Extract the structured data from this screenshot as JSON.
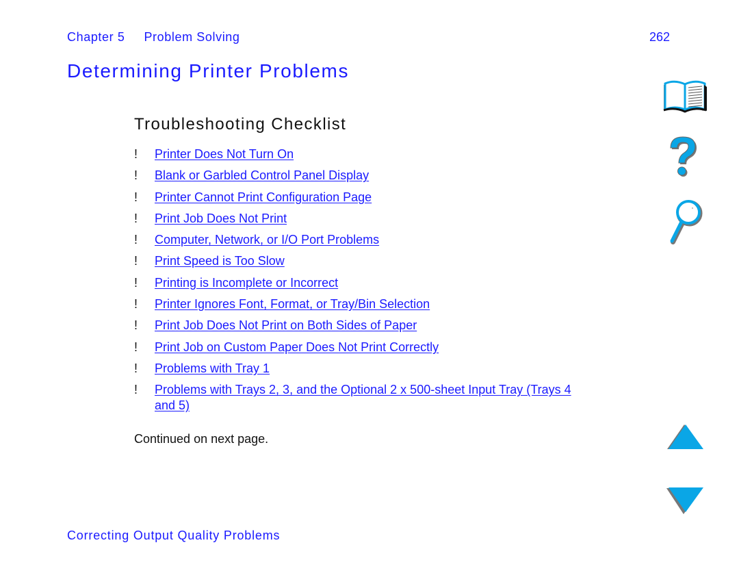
{
  "header": {
    "chapter_label": "Chapter 5",
    "chapter_title": "Problem Solving",
    "page_number": "262"
  },
  "page_title": "Determining Printer Problems",
  "section": {
    "title": "Troubleshooting Checklist",
    "bullet_glyph": "!",
    "items": [
      {
        "label": "Printer Does Not Turn On"
      },
      {
        "label": "Blank or Garbled Control Panel Display"
      },
      {
        "label": "Printer Cannot Print Configuration Page"
      },
      {
        "label": "Print Job Does Not Print"
      },
      {
        "label": "Computer, Network, or I/O Port Problems"
      },
      {
        "label": "Print Speed is Too Slow"
      },
      {
        "label": "Printing is Incomplete or Incorrect"
      },
      {
        "label": "Printer Ignores Font, Format, or Tray/Bin Selection"
      },
      {
        "label": "Print Job Does Not Print on Both Sides of Paper"
      },
      {
        "label": "Print Job on Custom Paper Does Not Print Correctly"
      },
      {
        "label": "Problems with Tray 1"
      },
      {
        "label": "Problems with Trays 2, 3, and the Optional 2 x 500-sheet Input Tray (Trays 4 and 5)"
      }
    ],
    "continued_note": "Continued on next page."
  },
  "footer": {
    "link_label": "Correcting Output Quality Problems"
  },
  "nav_icons": [
    {
      "name": "book-icon",
      "meaning": "contents"
    },
    {
      "name": "help-icon",
      "meaning": "help"
    },
    {
      "name": "search-icon",
      "meaning": "search / index"
    },
    {
      "name": "arrow-up-icon",
      "meaning": "previous page"
    },
    {
      "name": "arrow-down-icon",
      "meaning": "next page"
    }
  ],
  "colors": {
    "link": "#1a1aff",
    "text": "#111111",
    "icon_fill": "#0aa6e6",
    "icon_shadow": "#777777"
  }
}
